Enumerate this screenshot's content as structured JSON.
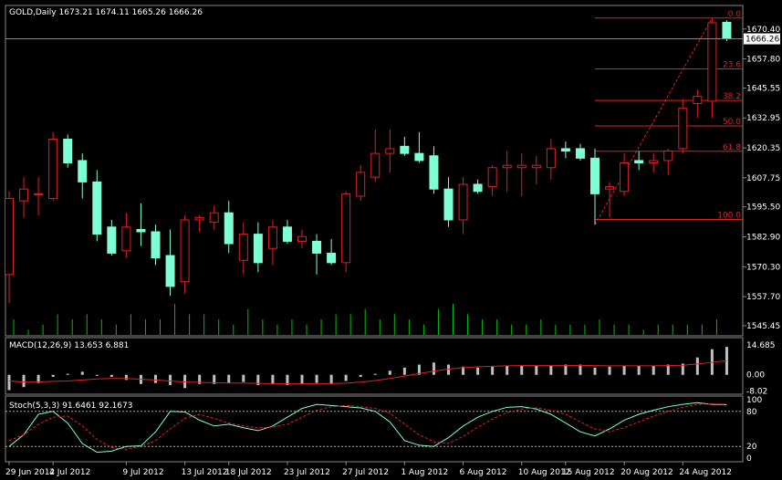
{
  "chart_data": [
    {
      "type": "candlestick",
      "title": "GOLD,Daily  1673.21 1674.11 1665.26 1666.26",
      "price_axis": {
        "ticks": [
          "1670.40",
          "1657.80",
          "1645.55",
          "1632.95",
          "1620.35",
          "1607.75",
          "1595.50",
          "1582.90",
          "1570.30",
          "1557.70",
          "1545.45"
        ],
        "tick_values": [
          1670.4,
          1657.8,
          1645.55,
          1632.95,
          1620.35,
          1607.75,
          1595.5,
          1582.9,
          1570.3,
          1557.7,
          1545.45
        ],
        "current_price": "1666.26",
        "ylim": [
          1543.5,
          1678.0
        ]
      },
      "candles": [
        {
          "o": 1567,
          "h": 1602,
          "l": 1555,
          "c": 1599
        },
        {
          "o": 1598,
          "h": 1608,
          "l": 1591,
          "c": 1603
        },
        {
          "o": 1601,
          "h": 1608,
          "l": 1592,
          "c": 1601
        },
        {
          "o": 1599,
          "h": 1627,
          "l": 1598,
          "c": 1624
        },
        {
          "o": 1624,
          "h": 1626,
          "l": 1612,
          "c": 1614
        },
        {
          "o": 1615,
          "h": 1618,
          "l": 1599,
          "c": 1606
        },
        {
          "o": 1606,
          "h": 1611,
          "l": 1581,
          "c": 1584
        },
        {
          "o": 1587,
          "h": 1590,
          "l": 1575,
          "c": 1576
        },
        {
          "o": 1577,
          "h": 1593,
          "l": 1574,
          "c": 1587
        },
        {
          "o": 1586,
          "h": 1597,
          "l": 1579,
          "c": 1585
        },
        {
          "o": 1585,
          "h": 1588,
          "l": 1571,
          "c": 1574
        },
        {
          "o": 1575,
          "h": 1586,
          "l": 1558,
          "c": 1562
        },
        {
          "o": 1564,
          "h": 1592,
          "l": 1559,
          "c": 1590
        },
        {
          "o": 1590,
          "h": 1592,
          "l": 1585,
          "c": 1591
        },
        {
          "o": 1589,
          "h": 1596,
          "l": 1586,
          "c": 1593
        },
        {
          "o": 1593,
          "h": 1598,
          "l": 1576,
          "c": 1580
        },
        {
          "o": 1573,
          "h": 1589,
          "l": 1567,
          "c": 1584
        },
        {
          "o": 1584,
          "h": 1589,
          "l": 1568,
          "c": 1572
        },
        {
          "o": 1578,
          "h": 1590,
          "l": 1571,
          "c": 1587
        },
        {
          "o": 1587,
          "h": 1590,
          "l": 1580,
          "c": 1581
        },
        {
          "o": 1581,
          "h": 1586,
          "l": 1578,
          "c": 1583
        },
        {
          "o": 1581,
          "h": 1584,
          "l": 1567,
          "c": 1576
        },
        {
          "o": 1576,
          "h": 1582,
          "l": 1571,
          "c": 1572
        },
        {
          "o": 1572,
          "h": 1602,
          "l": 1568,
          "c": 1601
        },
        {
          "o": 1600,
          "h": 1613,
          "l": 1598,
          "c": 1610
        },
        {
          "o": 1608,
          "h": 1628,
          "l": 1606,
          "c": 1618
        },
        {
          "o": 1618,
          "h": 1628,
          "l": 1610,
          "c": 1620
        },
        {
          "o": 1621,
          "h": 1625,
          "l": 1617,
          "c": 1618
        },
        {
          "o": 1618,
          "h": 1627,
          "l": 1614,
          "c": 1615
        },
        {
          "o": 1617,
          "h": 1621,
          "l": 1601,
          "c": 1603
        },
        {
          "o": 1603,
          "h": 1608,
          "l": 1587,
          "c": 1590
        },
        {
          "o": 1590,
          "h": 1608,
          "l": 1584,
          "c": 1605
        },
        {
          "o": 1605,
          "h": 1607,
          "l": 1601,
          "c": 1602
        },
        {
          "o": 1604,
          "h": 1613,
          "l": 1600,
          "c": 1612
        },
        {
          "o": 1612,
          "h": 1619,
          "l": 1602,
          "c": 1613
        },
        {
          "o": 1612,
          "h": 1618,
          "l": 1600,
          "c": 1613
        },
        {
          "o": 1612,
          "h": 1617,
          "l": 1605,
          "c": 1613
        },
        {
          "o": 1612,
          "h": 1624,
          "l": 1607,
          "c": 1620
        },
        {
          "o": 1620,
          "h": 1623,
          "l": 1616,
          "c": 1619
        },
        {
          "o": 1620,
          "h": 1622,
          "l": 1615,
          "c": 1616
        },
        {
          "o": 1616,
          "h": 1620,
          "l": 1588,
          "c": 1601
        },
        {
          "o": 1603,
          "h": 1606,
          "l": 1591,
          "c": 1604
        },
        {
          "o": 1602,
          "h": 1618,
          "l": 1600,
          "c": 1614
        },
        {
          "o": 1615,
          "h": 1619,
          "l": 1611,
          "c": 1614
        },
        {
          "o": 1614,
          "h": 1618,
          "l": 1610,
          "c": 1615
        },
        {
          "o": 1615,
          "h": 1620,
          "l": 1609,
          "c": 1619
        },
        {
          "o": 1620,
          "h": 1641,
          "l": 1618,
          "c": 1637
        },
        {
          "o": 1639,
          "h": 1645,
          "l": 1633,
          "c": 1642
        },
        {
          "o": 1640,
          "h": 1675,
          "l": 1633,
          "c": 1673
        },
        {
          "o": 1673.21,
          "h": 1674.11,
          "l": 1665.26,
          "c": 1666.26
        }
      ],
      "bull_color": "#e02020",
      "bear_color": "#7fffd4",
      "date_labels": [
        {
          "i": 0,
          "label": "29 Jun 2012"
        },
        {
          "i": 3,
          "label": "4 Jul 2012"
        },
        {
          "i": 8,
          "label": "9 Jul 2012"
        },
        {
          "i": 12,
          "label": "13 Jul 2012"
        },
        {
          "i": 15,
          "label": "18 Jul 2012"
        },
        {
          "i": 19,
          "label": "23 Jul 2012"
        },
        {
          "i": 23,
          "label": "27 Jul 2012"
        },
        {
          "i": 27,
          "label": "1 Aug 2012"
        },
        {
          "i": 31,
          "label": "6 Aug 2012"
        },
        {
          "i": 35,
          "label": "10 Aug 2012"
        },
        {
          "i": 38,
          "label": "15 Aug 2012"
        },
        {
          "i": 42,
          "label": "20 Aug 2012"
        },
        {
          "i": 46,
          "label": "24 Aug 2012"
        }
      ],
      "volume": [
        3,
        1,
        2,
        4,
        3,
        4,
        3,
        2,
        4,
        3,
        3,
        6,
        4,
        4,
        3,
        2,
        5,
        3,
        2,
        3,
        2,
        3,
        4,
        4,
        5,
        3,
        4,
        3,
        2,
        5,
        6,
        4,
        3,
        3,
        2,
        2,
        3,
        2,
        2,
        2,
        3,
        2,
        2,
        1,
        2,
        2,
        2,
        2,
        3,
        0
      ],
      "fibonacci": [
        {
          "label": "0.0",
          "price": 1675.0
        },
        {
          "label": "23.6",
          "price": 1653.6
        },
        {
          "label": "38.2",
          "price": 1640.3
        },
        {
          "label": "50.0",
          "price": 1629.6
        },
        {
          "label": "61.8",
          "price": 1618.9
        },
        {
          "label": "100.0",
          "price": 1590.2
        }
      ],
      "fib_trend": {
        "from": {
          "i": 40,
          "price": 1588
        },
        "to": {
          "i": 48,
          "price": 1675
        }
      },
      "grid": false
    },
    {
      "type": "bar",
      "title": "MACD(12,26,9) 13.653 6.881",
      "axis_ticks": [
        "14.685",
        "0.00",
        "-8.02"
      ],
      "axis_values": [
        14.685,
        0.0,
        -8.02
      ],
      "ylim": [
        -8.6,
        15.5
      ],
      "values": [
        -7.5,
        -6,
        -4,
        -1,
        0.5,
        1.5,
        -0.5,
        -1,
        -2.5,
        -4.5,
        -4,
        -5,
        -6.5,
        -4.5,
        -4.5,
        -4,
        -3.5,
        -5,
        -4.5,
        -5,
        -4.5,
        -4,
        -4.5,
        -3,
        -1,
        0.5,
        2,
        3.5,
        5,
        6,
        5,
        4,
        3.5,
        4,
        4.5,
        4.5,
        4.5,
        4.5,
        5,
        5,
        3.5,
        4,
        4.5,
        4.5,
        4.5,
        5,
        5.5,
        8.5,
        12.5,
        13.653
      ],
      "signal": [
        -3,
        -3.5,
        -3.5,
        -3.2,
        -3,
        -2.5,
        -2,
        -1.8,
        -1.8,
        -2.2,
        -2.5,
        -3,
        -3.5,
        -3.7,
        -3.9,
        -4,
        -4,
        -4.2,
        -4.3,
        -4.4,
        -4.4,
        -4.3,
        -4.3,
        -4.1,
        -3.6,
        -2.8,
        -1.8,
        -0.6,
        0.6,
        1.8,
        2.8,
        3.5,
        3.9,
        4.2,
        4.4,
        4.5,
        4.5,
        4.5,
        4.5,
        4.6,
        4.5,
        4.4,
        4.4,
        4.4,
        4.4,
        4.5,
        4.7,
        5.3,
        6.1,
        6.881
      ],
      "bar_color": "#c0c0c0",
      "signal_color": "#e02020"
    },
    {
      "type": "line",
      "title": "Stoch(5,3,3) 91.6461 92.1673",
      "axis_ticks": [
        "100",
        "80",
        "20",
        "0"
      ],
      "axis_values": [
        100,
        80,
        20,
        0
      ],
      "levels": [
        80,
        20
      ],
      "ylim": [
        0,
        100
      ],
      "main": [
        20,
        40,
        75,
        80,
        60,
        25,
        10,
        12,
        20,
        21,
        45,
        80,
        79,
        65,
        55,
        58,
        52,
        47,
        55,
        70,
        85,
        92,
        90,
        88,
        86,
        80,
        62,
        30,
        22,
        20,
        35,
        55,
        70,
        80,
        87,
        88,
        84,
        75,
        60,
        45,
        38,
        50,
        65,
        75,
        82,
        88,
        92,
        95,
        92,
        91.6461
      ],
      "signal": [
        30,
        40,
        58,
        70,
        72,
        55,
        32,
        18,
        15,
        20,
        30,
        50,
        68,
        75,
        68,
        60,
        55,
        52,
        53,
        58,
        70,
        82,
        88,
        90,
        88,
        85,
        77,
        58,
        40,
        28,
        25,
        37,
        53,
        67,
        78,
        84,
        86,
        82,
        75,
        62,
        50,
        45,
        52,
        62,
        72,
        80,
        87,
        92,
        93,
        92.1673
      ],
      "main_color": "#7fffd4",
      "signal_color": "#e02020"
    }
  ]
}
